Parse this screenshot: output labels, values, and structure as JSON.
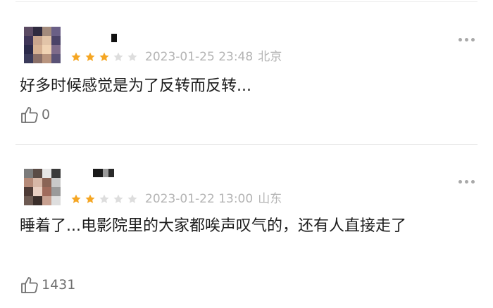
{
  "reviews": [
    {
      "rating": 3,
      "max_rating": 5,
      "date": "2023-01-25 23:48",
      "location": "北京",
      "content": "好多时候感觉是为了反转而反转...",
      "likes": "0",
      "star_color": "#f5a623",
      "star_empty_color": "#dddddd"
    },
    {
      "rating": 2,
      "max_rating": 5,
      "date": "2023-01-22 13:00",
      "location": "山东",
      "content": "睡着了...电影院里的大家都唉声叹气的，还有人直接走了",
      "likes": "1431",
      "star_color": "#f5a623",
      "star_empty_color": "#dddddd"
    }
  ],
  "icons": {
    "like": "thumbs-up-icon",
    "more": "more-dots-icon",
    "star": "star-icon"
  }
}
